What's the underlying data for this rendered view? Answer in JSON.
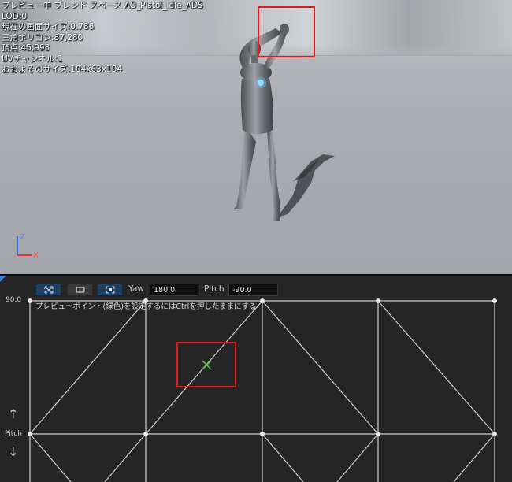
{
  "viewport": {
    "stats": [
      "プレビュー中 ブレンド スペース AO_Pistol_Idle_ADS",
      "LOD:0",
      "現在の画面サイズ:0.786",
      "三角ポリゴン:87,280",
      "頂点:45,993",
      "UVチャンネル:1",
      "おおよそのサイズ:104x63x194"
    ],
    "axis": {
      "z": "Z",
      "x": "X"
    }
  },
  "editor": {
    "toolbar": {
      "buttons": [
        "fit-view-icon",
        "show-sample-icon",
        "snap-grid-icon"
      ],
      "yaw_label": "Yaw",
      "yaw_value": "180.0",
      "pitch_label": "Pitch",
      "pitch_value": "-90.0"
    },
    "grid": {
      "y_max_label": "90.0",
      "hint": "プレビューポイント(緑色)を設定するにはCtrlを押したままにする",
      "vertical_axis_label": "Pitch",
      "arrow_up": "↑",
      "arrow_down": "↓"
    }
  },
  "colors": {
    "highlight": "#e01b1b",
    "preview_point": "#57c43a",
    "grid_line": "#cfcfcf",
    "toolbar_button": "#1e3e62",
    "accent": "#3b82d6"
  }
}
